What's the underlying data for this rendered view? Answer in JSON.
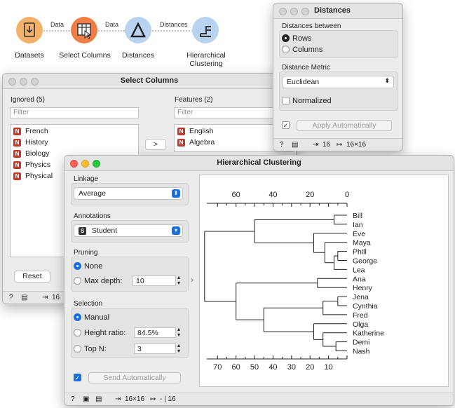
{
  "workflow": {
    "nodes": [
      {
        "label": "Datasets",
        "color": "#f3b16b",
        "icon": "file-icon"
      },
      {
        "label": "Select Columns",
        "color": "#ef7d45",
        "icon": "table-select-icon"
      },
      {
        "label": "Distances",
        "color": "#b8d3ef",
        "icon": "delta-icon"
      },
      {
        "label": "Hierarchical\nClustering",
        "color": "#b8d3ef",
        "icon": "dendrogram-icon"
      }
    ],
    "links": [
      "Data",
      "Data",
      "Distances"
    ]
  },
  "distances": {
    "title": "Distances",
    "between_label": "Distances between",
    "rows": "Rows",
    "columns": "Columns",
    "metric_label": "Distance Metric",
    "metric": "Euclidean",
    "normalized": "Normalized",
    "apply": "Apply Automatically",
    "status_in": "16",
    "status_out": "16×16"
  },
  "select_columns": {
    "title": "Select Columns",
    "ignored_label": "Ignored (5)",
    "features_label": "Features (2)",
    "filter_placeholder": "Filter",
    "ignored": [
      "French",
      "History",
      "Biology",
      "Physics",
      "Physical"
    ],
    "features": [
      "English",
      "Algebra"
    ],
    "move_button": ">",
    "reset_button": "Reset",
    "status_in": "16"
  },
  "hierarchical": {
    "title": "Hierarchical Clustering",
    "linkage_label": "Linkage",
    "linkage": "Average",
    "annotations_label": "Annotations",
    "annotation": "Student",
    "pruning_label": "Pruning",
    "pruning_none": "None",
    "pruning_depth": "Max depth:",
    "depth_value": "10",
    "selection_label": "Selection",
    "sel_manual": "Manual",
    "sel_height": "Height ratio:",
    "height_value": "84.5%",
    "sel_topn": "Top N:",
    "topn_value": "3",
    "send": "Send Automatically",
    "status_in": "16×16",
    "status_out": "- | 16"
  },
  "chart_data": {
    "type": "dendrogram",
    "leaves": [
      "Bill",
      "Ian",
      "Eve",
      "Maya",
      "Phill",
      "George",
      "Lea",
      "Ana",
      "Henry",
      "Jena",
      "Cynthia",
      "Fred",
      "Olga",
      "Katherine",
      "Demi",
      "Nash"
    ],
    "top_ticks": [
      60,
      40,
      20,
      0
    ],
    "bottom_ticks": [
      70,
      60,
      50,
      40,
      30,
      20,
      10
    ],
    "xlim": [
      75,
      0
    ],
    "merges": [
      {
        "a": "Bill",
        "b": "Ian",
        "height": 7
      },
      {
        "a": "Phill",
        "b": "George",
        "height": 5
      },
      {
        "a": "Phill+George",
        "b": "Lea",
        "height": 7
      },
      {
        "a": "Maya",
        "b": "Phill+George+Lea",
        "height": 12
      },
      {
        "a": "Eve",
        "b": "Maya+Phill+George+Lea",
        "height": 18
      },
      {
        "a": "Bill+Ian",
        "b": "Eve+Maya+Phill+George+Lea",
        "height": 50
      },
      {
        "a": "Jena",
        "b": "Cynthia",
        "height": 5
      },
      {
        "a": "Jena+Cynthia",
        "b": "Fred",
        "height": 13
      },
      {
        "a": "Ana",
        "b": "Henry",
        "height": 16
      },
      {
        "a": "Demi",
        "b": "Nash",
        "height": 6
      },
      {
        "a": "Katherine",
        "b": "Demi+Nash",
        "height": 13
      },
      {
        "a": "Olga",
        "b": "Katherine+Demi+Nash",
        "height": 18
      },
      {
        "a": "Jena+Cynthia+Fred",
        "b": "Olga+Katherine+Demi+Nash",
        "height": 45
      },
      {
        "a": "Ana+Henry",
        "b": "Jena..Nash",
        "height": 60
      },
      {
        "a": "Bill..Lea",
        "b": "Ana..Nash",
        "height": 77
      }
    ]
  }
}
